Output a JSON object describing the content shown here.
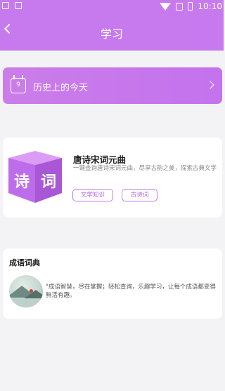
{
  "status_bar": {
    "time": "10:10"
  },
  "header": {
    "title": "学习"
  },
  "today_in_history": {
    "label": "历史上的今天",
    "calendar_number": "9"
  },
  "poetry_card": {
    "icon_text": [
      "诗",
      "词"
    ],
    "title": "唐诗宋词元曲",
    "description": "一键查询唐诗宋词元曲，尽享古韵之美，探索古典文学",
    "tags": [
      "文学知识",
      "古诗词"
    ]
  },
  "idiom_card": {
    "title": "成语词典",
    "description": "\"成语智慧，尽在掌握；轻松查询，乐趣学习，让每个成语都变得鲜活有趣。"
  },
  "colors": {
    "accent": "#c779ee",
    "tag_text": "#b067dd",
    "background": "#f3f3f5"
  }
}
